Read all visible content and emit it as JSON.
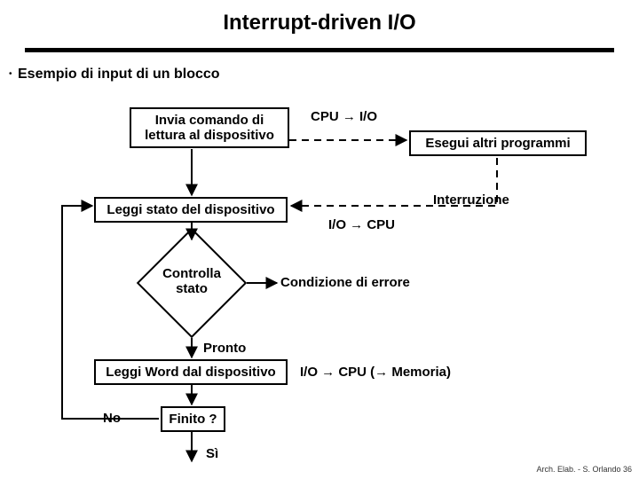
{
  "title": "Interrupt-driven I/O",
  "subtitle": "Esempio di input di un blocco",
  "box1_l1": "Invia comando di",
  "box1_l2": "lettura al dispositivo",
  "box2": "Leggi stato del dispositivo",
  "diamond_l1": "Controlla",
  "diamond_l2": "stato",
  "box3": "Leggi Word dal dispositivo",
  "box4": "Finito ?",
  "cpu_io": "CPU → I/O",
  "io_cpu": "I/O → CPU",
  "exec": "Esegui altri programmi",
  "intr": "Interruzione",
  "cond": "Condizione di errore",
  "memory": "I/O → CPU (→ Memoria)",
  "pronto": "Pronto",
  "si": "Sì",
  "no": "No",
  "footer": "Arch. Elab. - S. Orlando 36"
}
